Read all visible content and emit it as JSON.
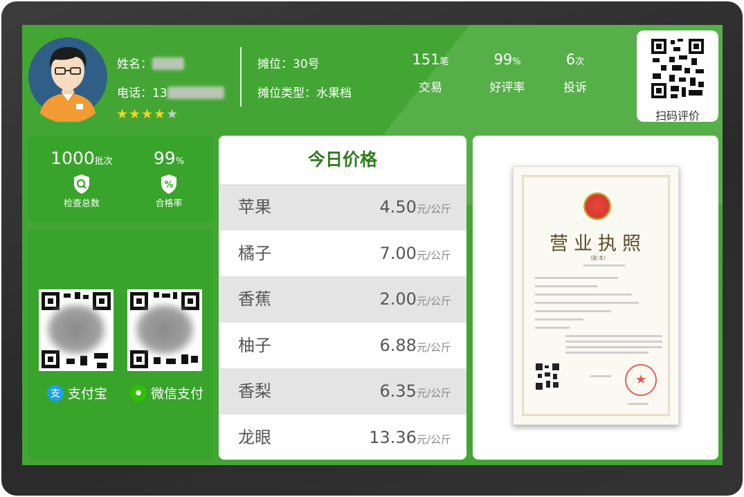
{
  "vendor": {
    "name_label": "姓名：",
    "phone_label": "电话：",
    "phone_prefix": "13",
    "stall_label": "摊位：30号",
    "stall_type_label": "摊位类型：水果档",
    "stars": {
      "filled": 3,
      "half": 1,
      "empty": 1
    }
  },
  "stats": {
    "trades": {
      "value": "151",
      "unit": "笔",
      "label": "交易"
    },
    "rating": {
      "value": "99",
      "unit": "%",
      "label": "好评率"
    },
    "complaints": {
      "value": "6",
      "unit": "次",
      "label": "投诉"
    }
  },
  "scan_review": {
    "label": "扫码评价"
  },
  "inspection": {
    "total": {
      "value": "1000",
      "unit": "批次",
      "label": "检查总数"
    },
    "pass": {
      "value": "99",
      "unit": "%",
      "label": "合格率"
    }
  },
  "payments": {
    "alipay": {
      "label": "支付宝",
      "icon_glyph": "支",
      "color": "#1aa3e8"
    },
    "wechat": {
      "label": "微信支付",
      "icon_glyph": "●",
      "color": "#2dc100"
    }
  },
  "prices": {
    "title": "今日价格",
    "unit": "元/公斤",
    "items": [
      {
        "name": "苹果",
        "price": "4.50"
      },
      {
        "name": "橘子",
        "price": "7.00"
      },
      {
        "name": "香蕉",
        "price": "2.00"
      },
      {
        "name": "柚子",
        "price": "6.88"
      },
      {
        "name": "香梨",
        "price": "6.35"
      },
      {
        "name": "龙眼",
        "price": "13.36"
      }
    ]
  },
  "license": {
    "title": "营业执照",
    "subtitle": "(副 本)"
  },
  "colors": {
    "screen": "#43a634",
    "panel": "#39a42b",
    "title_green": "#2e7d1f",
    "star": "#f7d51d"
  }
}
